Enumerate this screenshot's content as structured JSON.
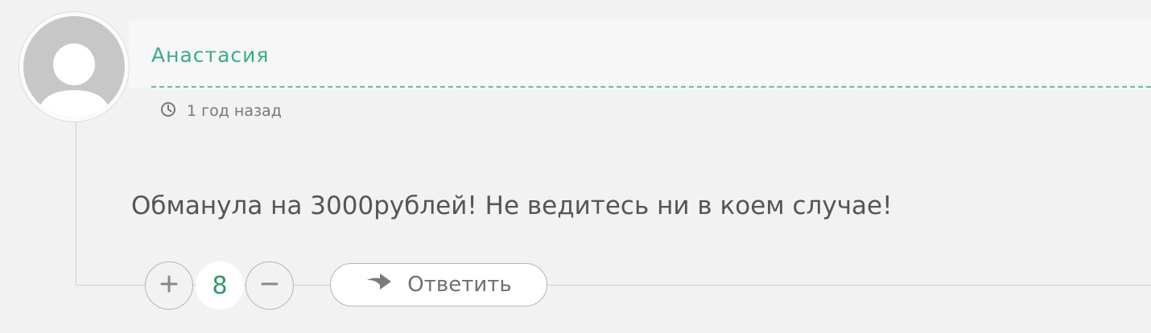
{
  "comment": {
    "author": "Анастасия",
    "time": "1 год назад",
    "text": "Обманула на 3000рублей! Не ведитесь ни в коем случае!",
    "votes": "8",
    "reply_label": "Ответить"
  },
  "colors": {
    "accent": "#3bab8b",
    "vote_count": "#2e9a6d",
    "background": "#f2f2f2",
    "avatar_placeholder": "#c7c7c7"
  },
  "icons": {
    "avatar": "user-silhouette-icon",
    "time": "clock-icon",
    "upvote": "plus-icon",
    "downvote": "minus-icon",
    "reply": "reply-arrow-icon"
  }
}
